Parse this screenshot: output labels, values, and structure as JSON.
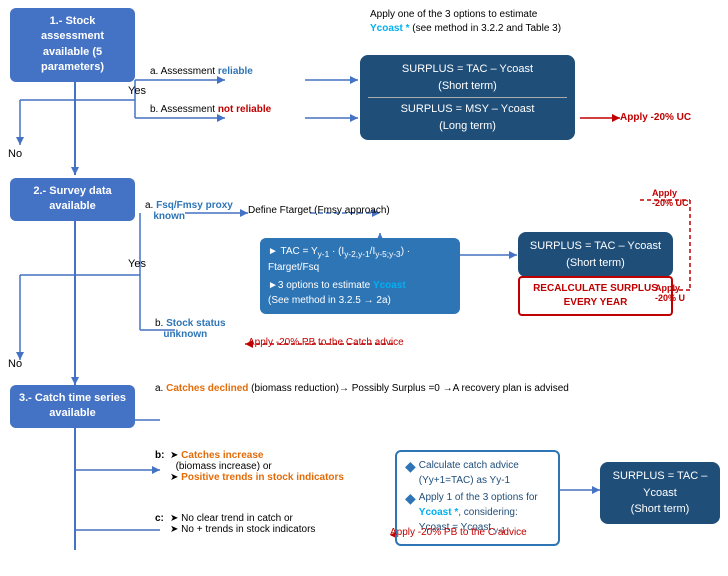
{
  "sections": {
    "s1": {
      "label": "1.- Stock assessment\navailable (5 parameters)"
    },
    "s2": {
      "label": "2.- Survey data  available"
    },
    "s3": {
      "label": "3.- Catch time series\navailable"
    }
  },
  "labels": {
    "no": "No",
    "yes": "Yes",
    "apply_note": "Apply one of the 3 options to estimate",
    "ycoast_star": "Ycoast *",
    "see_method": "(see method in 3.2.2 and Table 3)",
    "a_reliable": "a. Assessment",
    "reliable": "reliable",
    "b_not_reliable": "b. Assessment",
    "not_reliable": "not reliable",
    "apply_uc": "Apply -20% UC",
    "surplus_short": "SURPLUS = TAC – Ycoast\n(Short term)",
    "surplus_msy": "SURPLUS = MSY – Ycoast\n(Long term)",
    "a_fsq": "a.",
    "fsq_known": "Fsq/Fmsy proxy\nknown",
    "define_ftarget": "Define Ftarget (Fmsy approach)",
    "apply_20uc": "Apply\n-20% UC",
    "tac_formula": "► TAC = Yy-1 · (Iy-2,y-1/Iy-5;y-3) · Ftarget/Fsq",
    "three_options": "►3 options to estimate Ycoast\n(See method in  3.2.5 → 2a)",
    "surplus_short2": "SURPLUS = TAC – Ycoast\n(Short term)",
    "recalculate": "RECALCULATE SURPLUS\nEVERY YEAR",
    "apply_20uc2": "Apply\n-20% U",
    "b_stock_unknown": "b. Stock status\nunknown",
    "apply_pb": "Apply -20% PB to the Catch advice",
    "catches_declined": "a. Catches declined",
    "biomass_reduction": "(biomass reduction)→ Possibly Surplus =0 →A recovery plan is advised",
    "b_label": "b:",
    "catches_increase": "Catches increase",
    "biomass_increase": "(biomass increase) or",
    "positive_trends": "Positive trends in stock indicators",
    "c_label": "c:",
    "no_clear_trend": "No clear trend in catch or",
    "no_plus_trends": "No + trends in stock indicators",
    "calc_advice1": "Calculate catch\nadvice (Yy+1=TAC) as Yy-1",
    "calc_advice2": "Apply 1 of the 3 options\nfor Ycoast *, considering:\nYcoast = Ycoast y-1",
    "surplus_short3": "SURPLUS = TAC – Ycoast\n(Short term)",
    "apply_20pb": "Apply -20% PB to the C advice"
  }
}
